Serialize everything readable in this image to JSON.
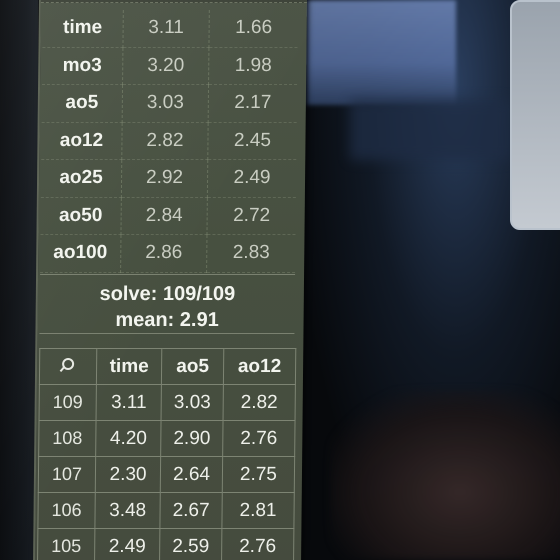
{
  "stats": {
    "rows": [
      {
        "label": "time",
        "current": "3.11",
        "best": "1.66"
      },
      {
        "label": "mo3",
        "current": "3.20",
        "best": "1.98"
      },
      {
        "label": "ao5",
        "current": "3.03",
        "best": "2.17"
      },
      {
        "label": "ao12",
        "current": "2.82",
        "best": "2.45"
      },
      {
        "label": "ao25",
        "current": "2.92",
        "best": "2.49"
      },
      {
        "label": "ao50",
        "current": "2.84",
        "best": "2.72"
      },
      {
        "label": "ao100",
        "current": "2.86",
        "best": "2.83"
      }
    ]
  },
  "summary": {
    "solve_line": "solve: 109/109",
    "mean_line": "mean: 2.91"
  },
  "times": {
    "search_icon": "search-icon",
    "headers": [
      "time",
      "ao5",
      "ao12"
    ],
    "rows": [
      {
        "idx": "109",
        "time": "3.11",
        "ao5": "3.03",
        "ao12": "2.82"
      },
      {
        "idx": "108",
        "time": "4.20",
        "ao5": "2.90",
        "ao12": "2.76"
      },
      {
        "idx": "107",
        "time": "2.30",
        "ao5": "2.64",
        "ao12": "2.75"
      },
      {
        "idx": "106",
        "time": "3.48",
        "ao5": "2.67",
        "ao12": "2.81"
      },
      {
        "idx": "105",
        "time": "2.49",
        "ao5": "2.59",
        "ao12": "2.76"
      }
    ]
  },
  "colors": {
    "panel_bg": "#4a5244",
    "text_primary": "#f2f4ee",
    "text_secondary": "#c9cdc2",
    "border": "#7d8473"
  }
}
